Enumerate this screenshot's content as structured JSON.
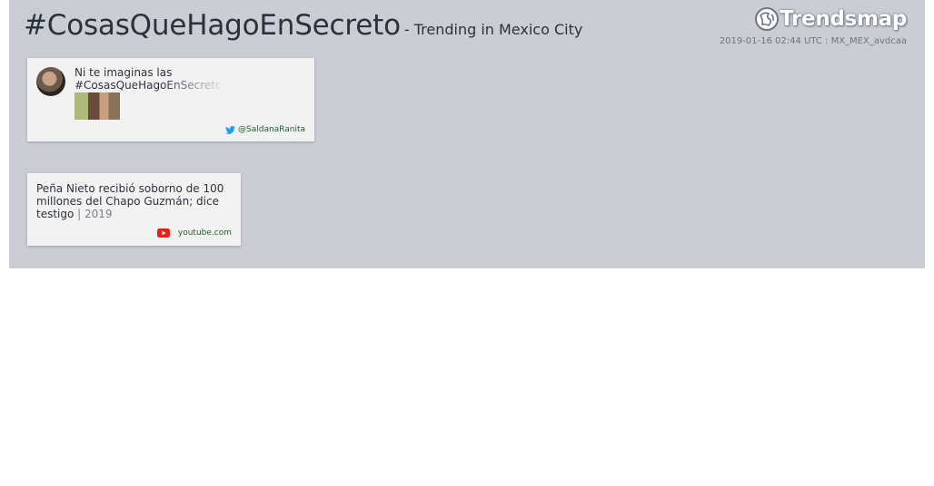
{
  "header": {
    "hashtag": "#CosasQueHagoEnSecreto",
    "subtitle": "- Trending in Mexico City",
    "brand": "Trendsmap",
    "meta": "2019-01-16 02:44 UTC : MX_MEX_avdcaa"
  },
  "tweet": {
    "text_line1": "Ni te imaginas las",
    "text_line2": "#CosasQueHagoEnSecreto",
    "user": "@SaldanaRanita",
    "icon": "twitter-bird-icon"
  },
  "news": {
    "headline": "Peña Nieto recibió soborno de 100 millones del Chapo Guzmán; dice testigo",
    "year": "| 2019",
    "source": "youtube.com",
    "icon": "youtube-icon"
  },
  "colors": {
    "panel": "#cacdd4",
    "card": "#f2f2f2",
    "text": "#2b323d",
    "link": "#1d5e2b",
    "twitter": "#1da1f2",
    "youtube": "#e62117"
  }
}
